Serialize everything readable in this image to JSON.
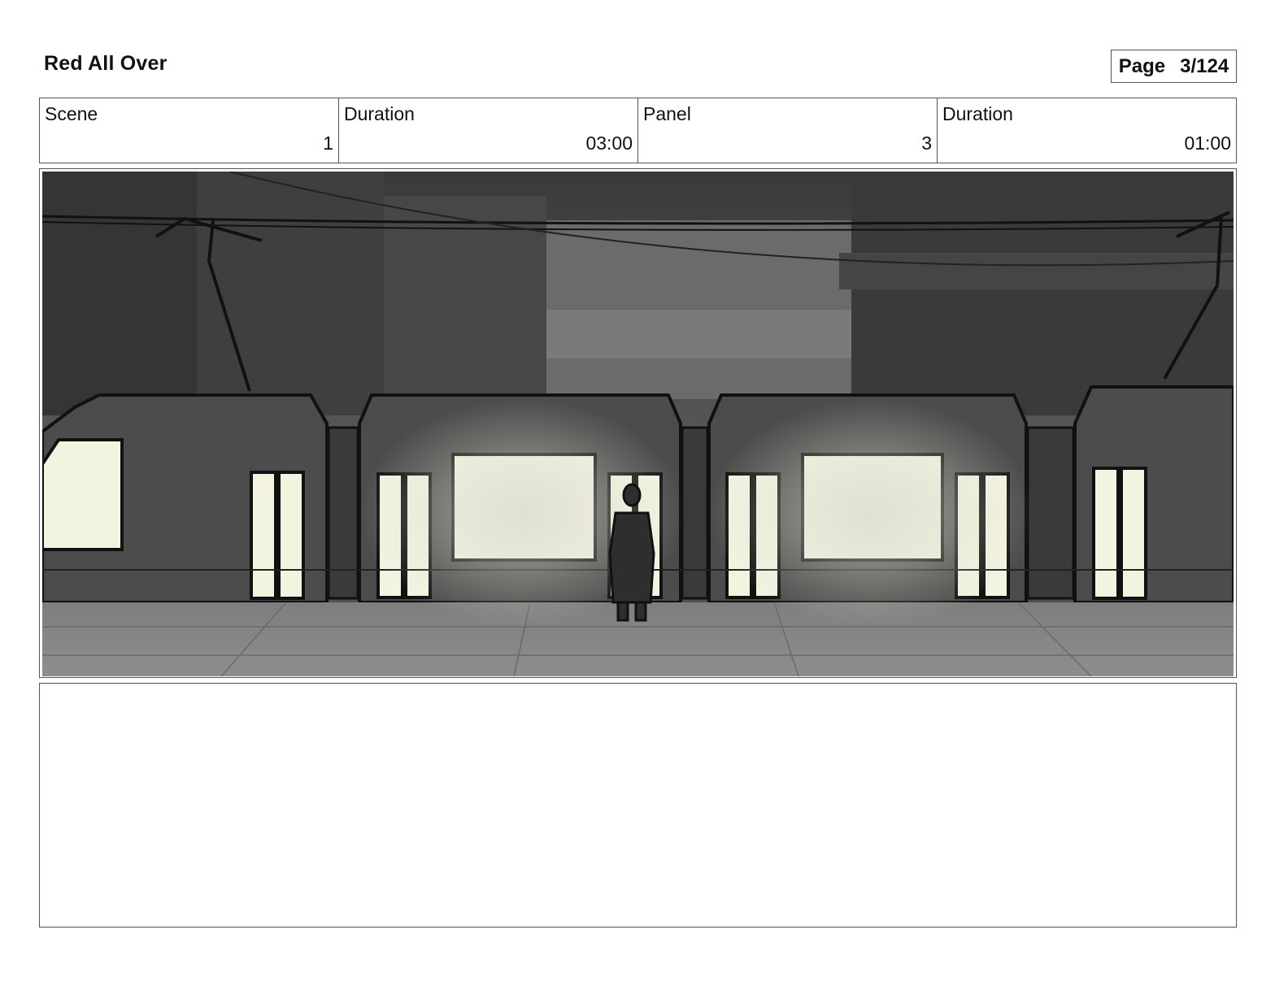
{
  "document": {
    "title": "Red All Over",
    "page_label": "Page",
    "page_number": "3/124"
  },
  "info": {
    "scene_label": "Scene",
    "scene_value": "1",
    "scene_duration_label": "Duration",
    "scene_duration_value": "03:00",
    "panel_label": "Panel",
    "panel_value": "3",
    "panel_duration_label": "Duration",
    "panel_duration_value": "01:00"
  },
  "panel_image": {
    "description_icon": "storyboard-sketch-tram-platform"
  },
  "notes": {
    "text": ""
  }
}
